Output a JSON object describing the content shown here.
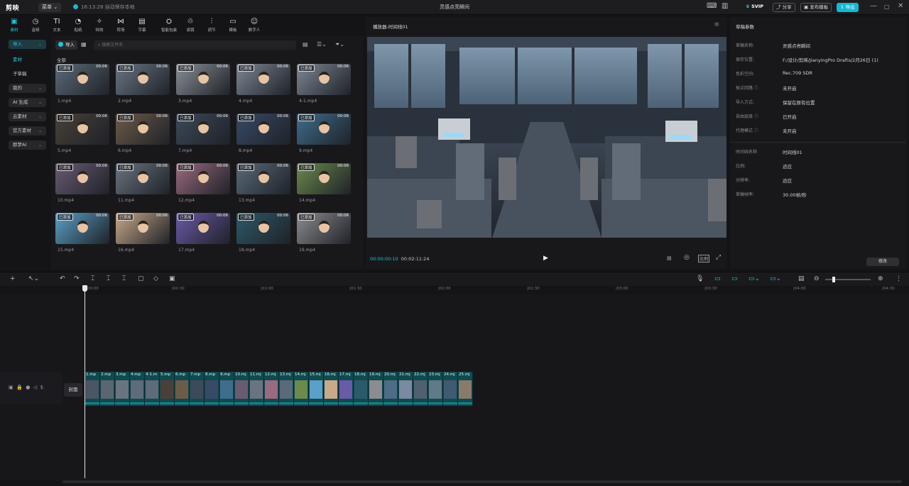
{
  "app": {
    "logo": "剪映",
    "menu_label": "菜单",
    "autosave": "16:13:28 自动保存本地",
    "project_title": "灵感点亮瞬间"
  },
  "titlebar_buttons": {
    "svip": "SVIP",
    "share": "分享",
    "publish": "发布模板",
    "export": "导出"
  },
  "top_tabs": [
    {
      "icon": "media-icon",
      "label": "素材"
    },
    {
      "icon": "audio-icon",
      "label": "音频"
    },
    {
      "icon": "text-icon",
      "label": "文本"
    },
    {
      "icon": "sticker-icon",
      "label": "贴纸"
    },
    {
      "icon": "effects-icon",
      "label": "特效"
    },
    {
      "icon": "transition-icon",
      "label": "转场"
    },
    {
      "icon": "caption-icon",
      "label": "字幕"
    },
    {
      "icon": "smart-pack-icon",
      "label": "智能包装"
    },
    {
      "icon": "filter-icon",
      "label": "滤镜"
    },
    {
      "icon": "adjust-icon",
      "label": "调节"
    },
    {
      "icon": "template-icon",
      "label": "模板"
    },
    {
      "icon": "digital-human-icon",
      "label": "数字人"
    }
  ],
  "left_nav": [
    {
      "label": "导入",
      "caret": true,
      "style": "on"
    },
    {
      "label": "素材",
      "caret": false,
      "style": "text-on"
    },
    {
      "label": "子草稿",
      "caret": false,
      "style": ""
    },
    {
      "label": "我的",
      "caret": true,
      "style": "pill"
    },
    {
      "label": "AI 生成",
      "caret": true,
      "style": "pill"
    },
    {
      "label": "云素材",
      "caret": true,
      "style": "pill"
    },
    {
      "label": "官方素材",
      "caret": true,
      "style": "pill"
    },
    {
      "label": "即梦AI",
      "caret": true,
      "style": "pill"
    }
  ],
  "media": {
    "import_label": "导入",
    "search_placeholder": "搜索文件名",
    "all_label": "全部",
    "added_tag": "已添加",
    "items": [
      {
        "name": "1.mp4",
        "dur": "00:06"
      },
      {
        "name": "2.mp4",
        "dur": "00:06"
      },
      {
        "name": "3.mp4",
        "dur": "00:06"
      },
      {
        "name": "4.mp4",
        "dur": "00:06"
      },
      {
        "name": "4-1.mp4",
        "dur": "00:06"
      },
      {
        "name": "5.mp4",
        "dur": "00:06"
      },
      {
        "name": "6.mp4",
        "dur": "00:06"
      },
      {
        "name": "7.mp4",
        "dur": "00:06"
      },
      {
        "name": "8.mp4",
        "dur": "00:06"
      },
      {
        "name": "9.mp4",
        "dur": "00:06"
      },
      {
        "name": "10.mp4",
        "dur": "00:06"
      },
      {
        "name": "11.mp4",
        "dur": "00:06"
      },
      {
        "name": "12.mp4",
        "dur": "00:06"
      },
      {
        "name": "13.mp4",
        "dur": "00:06"
      },
      {
        "name": "14.mp4",
        "dur": "00:06"
      },
      {
        "name": "15.mp4",
        "dur": "00:06"
      },
      {
        "name": "16.mp4",
        "dur": "00:06"
      },
      {
        "name": "17.mp4",
        "dur": "00:06"
      },
      {
        "name": "18.mp4",
        "dur": "00:06"
      },
      {
        "name": "19.mp4",
        "dur": "00:06"
      }
    ]
  },
  "player": {
    "title": "播放器-时间线01",
    "current": "00:00:00:10",
    "total": "00:02:11:24",
    "ratio_label": "比例"
  },
  "props": {
    "header": "草稿参数",
    "rows": [
      {
        "k": "草稿名称:",
        "v": "灵感点亮瞬间"
      },
      {
        "k": "保存位置:",
        "v": "F:/设计/剪映/JianyingPro Drafts/2月26日 (1)"
      },
      {
        "k": "色彩空间:",
        "v": "Rec.709 SDR"
      },
      {
        "k": "採点回路 ⓘ",
        "v": "未开启"
      },
      {
        "k": "导入方式:",
        "v": "保留在原有位置"
      },
      {
        "k": "自由层级 ⓘ",
        "v": "已开启"
      },
      {
        "k": "代理模式 ⓘ",
        "v": "未开启"
      },
      {
        "k": "时间线名称",
        "v": "时间线01"
      },
      {
        "k": "比例:",
        "v": "适应"
      },
      {
        "k": "分辨率:",
        "v": "适应"
      },
      {
        "k": "草稿帧率:",
        "v": "30.00帧/秒"
      }
    ],
    "modify_label": "修改"
  },
  "timeline": {
    "ruler": [
      "00:00",
      "|00:30",
      "|01:00",
      "|01:30",
      "|02:00",
      "|02:30",
      "|03:00",
      "|03:30",
      "|04:00",
      "|04:30"
    ],
    "cover_label": "封面",
    "clips": [
      "1.mp",
      "2.mp",
      "3.mp",
      "4.mp",
      "4-1.m",
      "5.mp",
      "6.mp",
      "7.mp",
      "8.mp",
      "9.mp",
      "10.mj",
      "11.mj",
      "12.mj",
      "13.mj",
      "14.mj",
      "15.mj",
      "16.mj",
      "17.mj",
      "18.mj",
      "19.mj",
      "20.mj",
      "21.mj",
      "22.mj",
      "23.mj",
      "24.mj",
      "25.mj"
    ]
  },
  "colors": {
    "accent": "#20c5e0",
    "bg": "#141416",
    "panel": "#18181b",
    "clip": "#0f4a4f"
  }
}
